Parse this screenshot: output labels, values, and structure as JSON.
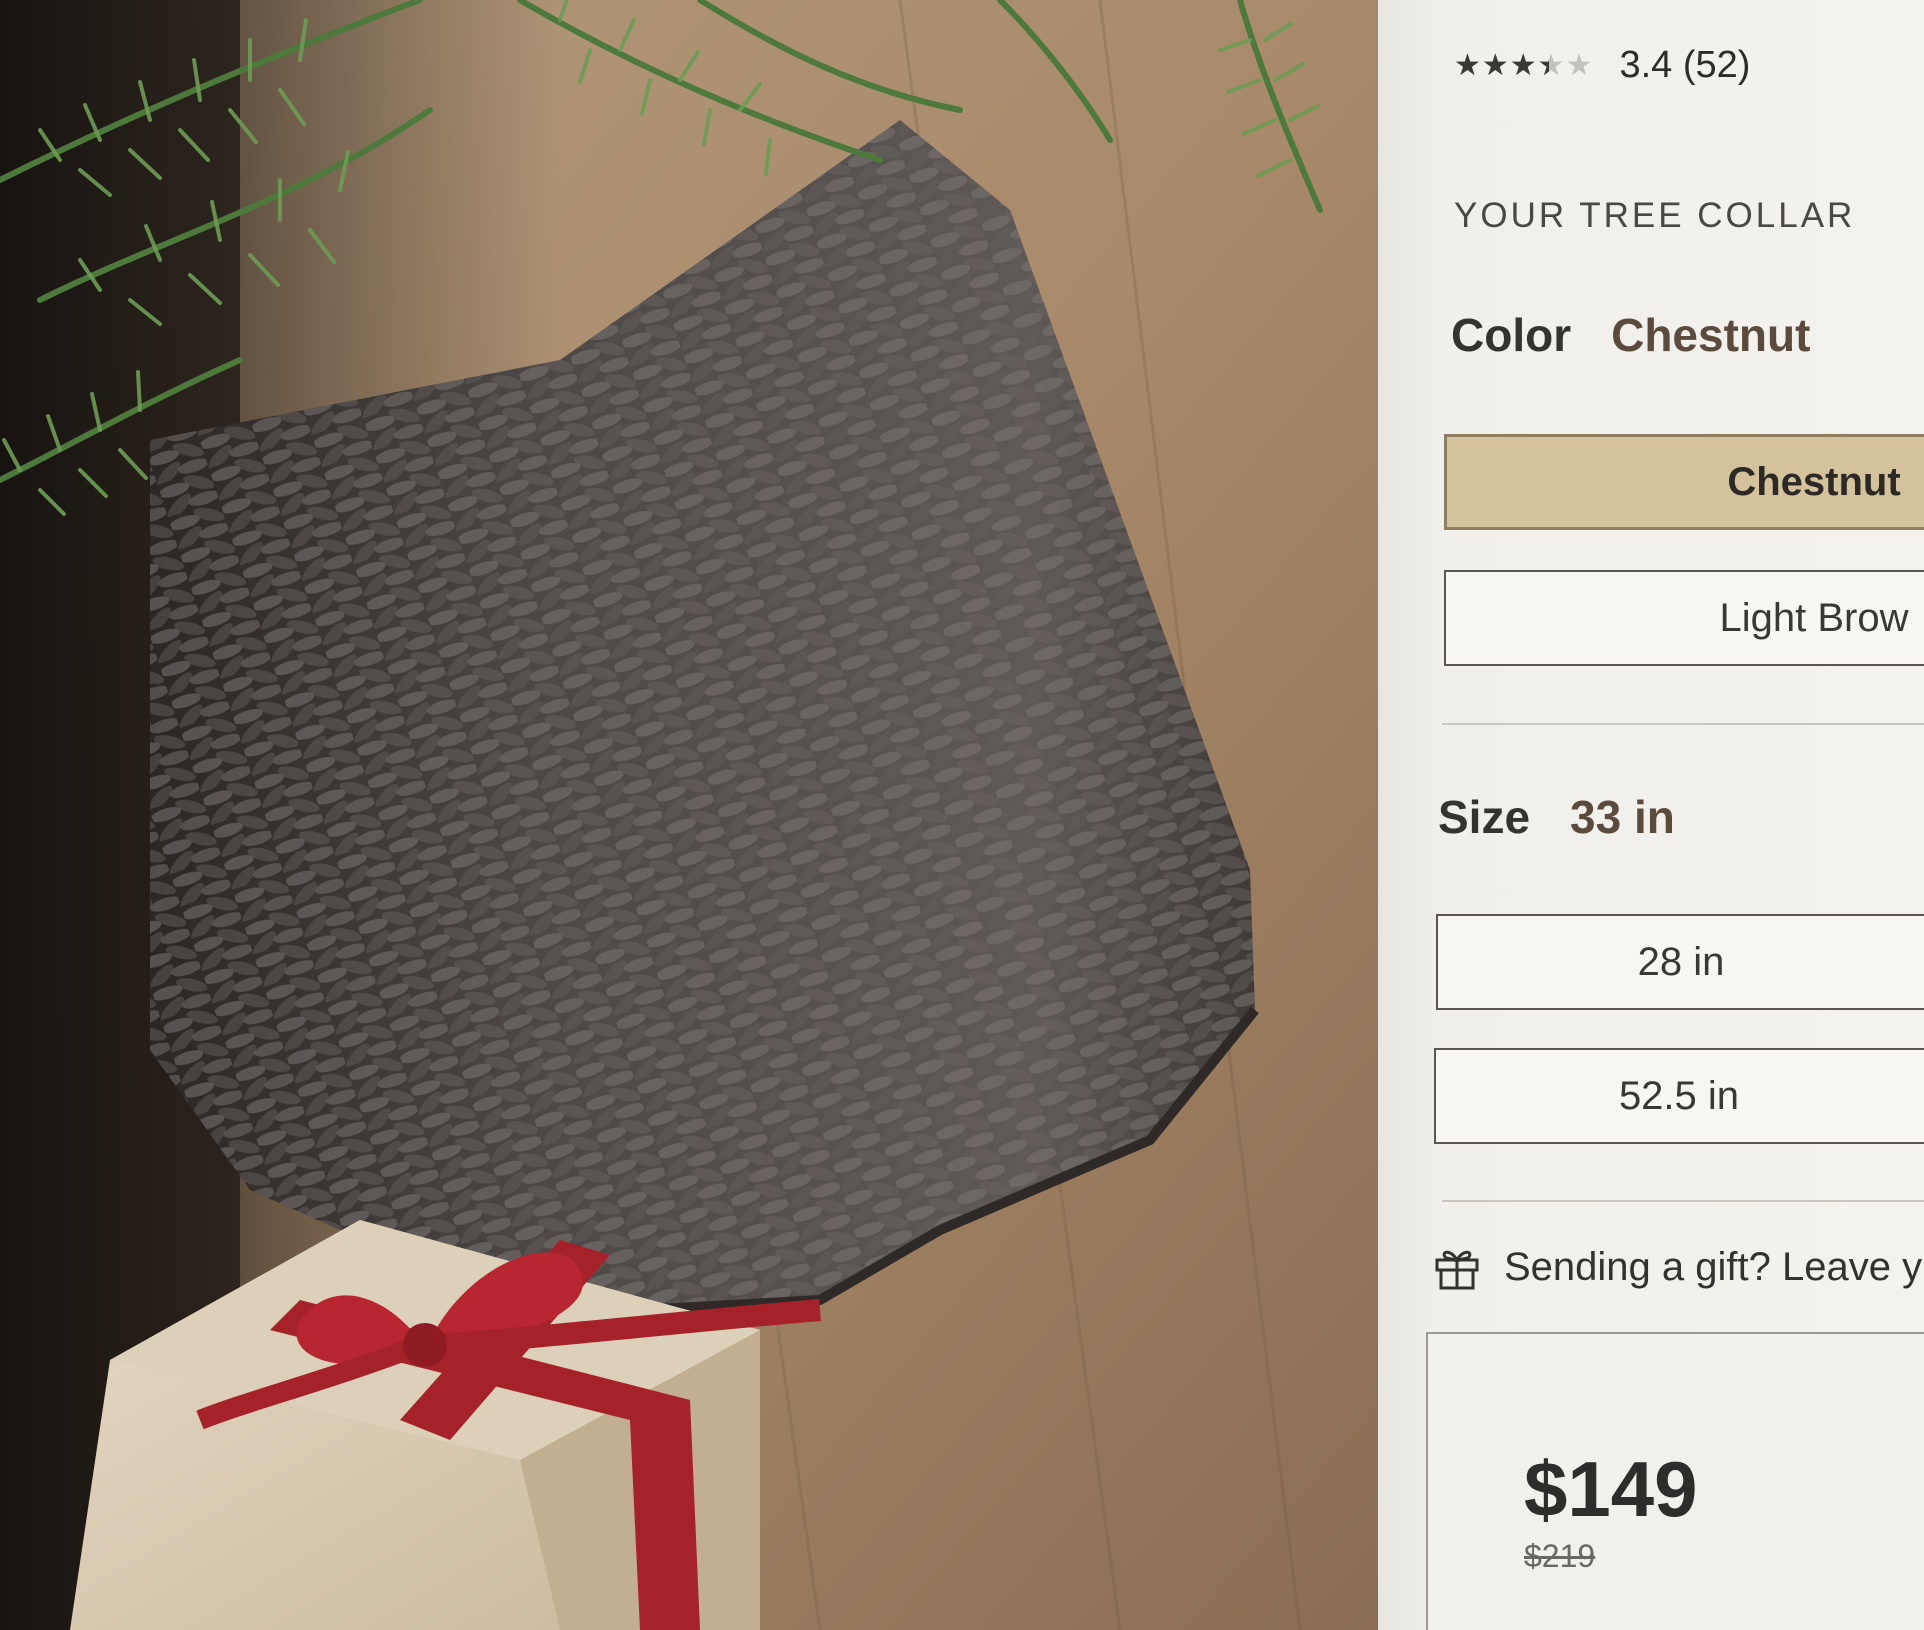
{
  "rating": {
    "stars_filled": 3.4,
    "stars_total": 5,
    "text": "3.4 (52)"
  },
  "section_label": "YOUR TREE COLLAR",
  "color": {
    "label": "Color",
    "selected": "Chestnut",
    "options": [
      {
        "label": "Chestnut",
        "selected": true
      },
      {
        "label": "Light Brow",
        "selected": false
      }
    ]
  },
  "size": {
    "label": "Size",
    "selected": "33 in",
    "options": [
      {
        "label": "28 in"
      },
      {
        "label": "52.5 in"
      }
    ]
  },
  "gift": {
    "text": "Sending a gift? Leave y",
    "icon": "gift-icon"
  },
  "price": {
    "current": "$149",
    "original": "$219"
  },
  "colors": {
    "selected_swatch": "#d4c29c",
    "panel_bg": "#f4f2ee",
    "ribbon": "#a5222b",
    "wicker": "#5b5550"
  }
}
